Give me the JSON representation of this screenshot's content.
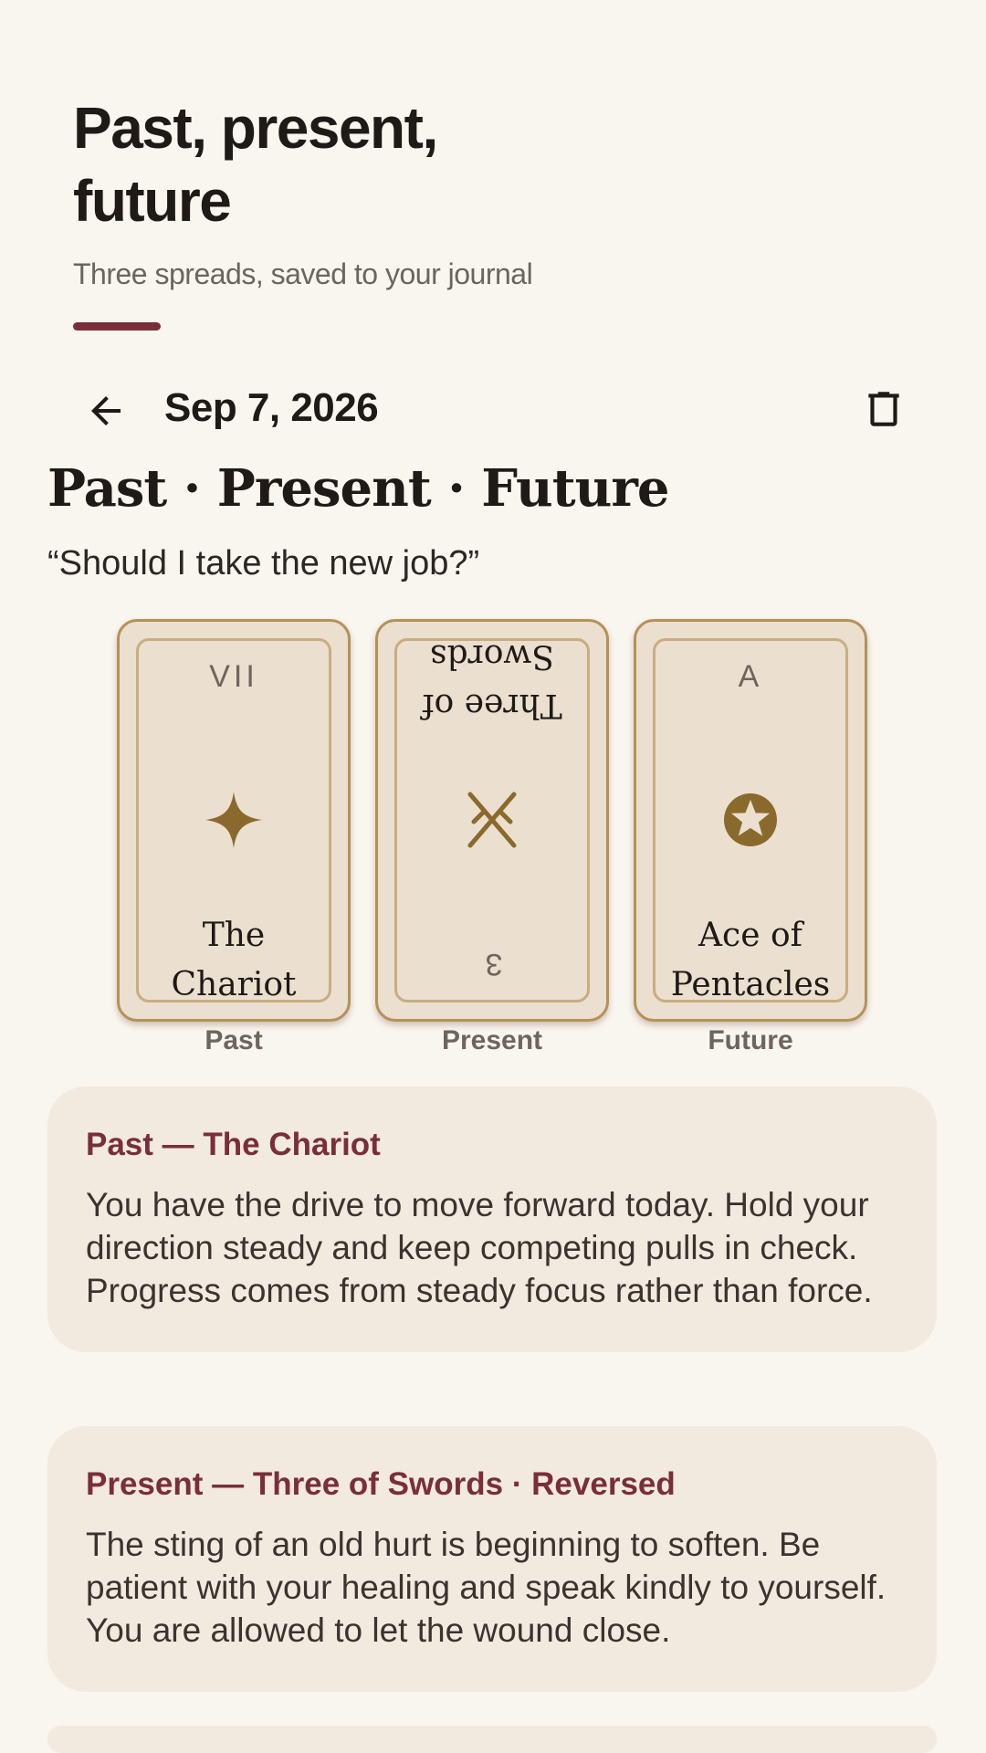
{
  "header": {
    "title": "Past, present, future",
    "subtitle": "Three spreads, saved to your journal"
  },
  "toolbar": {
    "back_icon": "arrow-left-icon",
    "date": "Sep 7, 2026",
    "delete_icon": "trash-icon"
  },
  "entry": {
    "spread_title": "Past · Present · Future",
    "question": "“Should I take the new job?”"
  },
  "cards": [
    {
      "numeral": "VII",
      "name": "The Chariot",
      "position": "Past",
      "symbol": "four-point-star-icon",
      "reversed": false
    },
    {
      "numeral": "3",
      "name": "Three of Swords",
      "position": "Present",
      "symbol": "crossed-swords-icon",
      "reversed": true
    },
    {
      "numeral": "A",
      "name": "Ace of Pentacles",
      "position": "Future",
      "symbol": "pentacle-icon",
      "reversed": false
    }
  ],
  "readings": [
    {
      "heading": "Past — The Chariot",
      "text": "You have the drive to move forward today. Hold your direction steady and keep competing pulls in check. Progress comes from steady focus rather than force."
    },
    {
      "heading": "Present — Three of Swords · Reversed",
      "text": "The sting of an old hurt is beginning to soften. Be patient with your healing and speak kindly to yourself. You are allowed to let the wound close."
    }
  ],
  "colors": {
    "background": "#f9f5ef",
    "accent": "#7a2e3a",
    "card_face": "#ebdfcf",
    "card_border": "#b5915a",
    "symbol_gold": "#8a6a2c",
    "reading_panel": "#f3eadf"
  }
}
